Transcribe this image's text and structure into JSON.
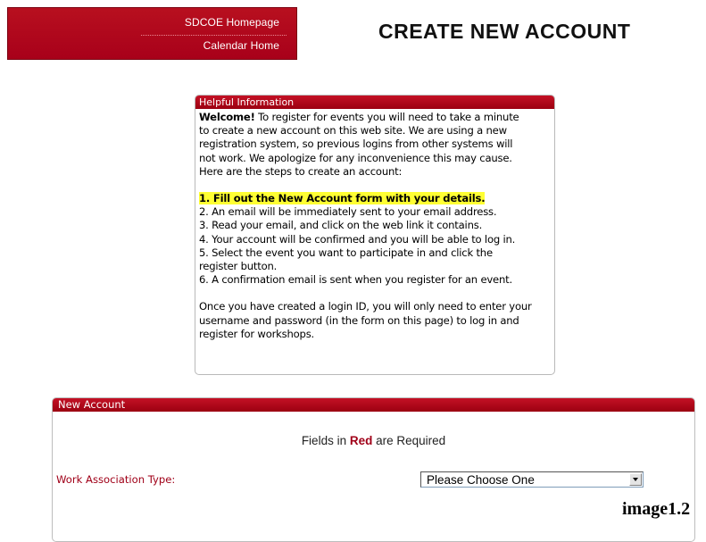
{
  "nav": {
    "links": [
      "SDCOE Homepage",
      "Calendar Home"
    ]
  },
  "page_title": "CREATE NEW ACCOUNT",
  "info_panel": {
    "header": "Helpful Information",
    "welcome_bold": "Welcome!",
    "intro_lines": [
      " To register for events you will need to take a minute",
      "to create a new account on this web site. We are using a new",
      "registration system, so previous logins from other systems will",
      "not work. We apologize for any inconvenience this may cause.",
      "Here are the steps to create an account:"
    ],
    "steps": [
      "1. Fill out the New Account form with your details.",
      "2. An email will be immediately sent to your email address.",
      "3. Read your email, and click on the web link it contains.",
      "4. Your account will be confirmed and you will be able to log in.",
      "5. Select the event you want to participate in and click the",
      "register button.",
      "6. A confirmation email is sent when you register for an event."
    ],
    "outro_lines": [
      "Once you have created a login ID, you will only need to enter your",
      "username and password (in the form on this page) to log in and",
      "register for workshops."
    ]
  },
  "account_panel": {
    "header": "New Account",
    "required_prefix": "Fields in ",
    "required_word": "Red",
    "required_suffix": " are Required",
    "work_association_label": "Work Association Type:",
    "work_association_value": "Please Choose One"
  },
  "caption": "image1.2",
  "colors": {
    "brand_red": "#a8001a",
    "panel_header_red": "#b20c1f",
    "required_red": "#a00018",
    "highlight_yellow": "#ffff33"
  }
}
